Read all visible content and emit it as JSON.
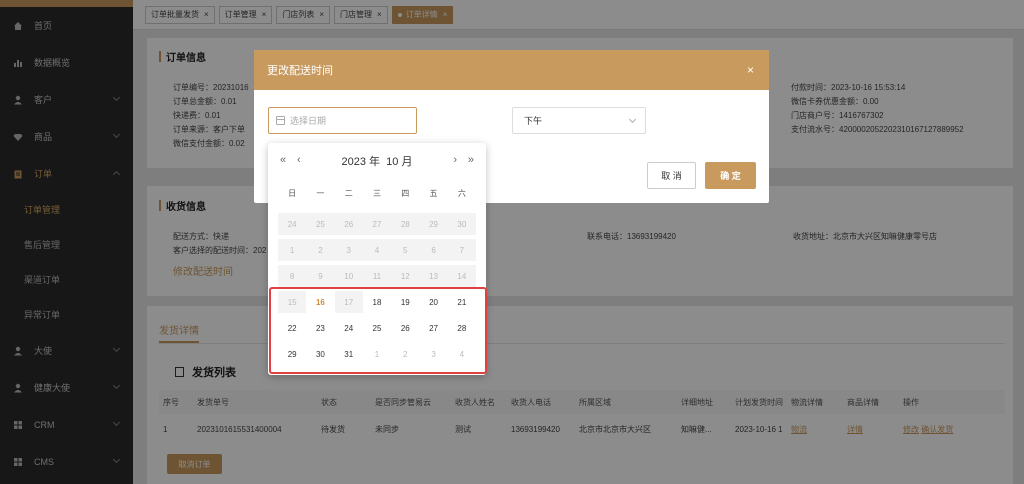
{
  "sidebar": {
    "items": [
      {
        "label": "首页",
        "icon": "home-icon"
      },
      {
        "label": "数据概览",
        "icon": "chart-icon"
      },
      {
        "label": "客户",
        "icon": "user-icon"
      },
      {
        "label": "商品",
        "icon": "diamond-icon"
      },
      {
        "label": "订单",
        "icon": "clipboard-icon"
      }
    ],
    "sub_items": [
      "订单管理",
      "售后管理",
      "渠道订单",
      "异常订单"
    ],
    "bottom_items": [
      {
        "label": "大使",
        "icon": "user-icon"
      },
      {
        "label": "健康大使",
        "icon": "user-icon"
      },
      {
        "label": "CRM",
        "icon": "grid-icon"
      },
      {
        "label": "CMS",
        "icon": "grid-icon"
      }
    ]
  },
  "tabs": [
    "订单批量发货",
    "订单管理",
    "门店列表",
    "门店管理",
    "订单详情"
  ],
  "order_info": {
    "title": "订单信息",
    "left": [
      "订单编号：20231016",
      "订单总金额：0.01",
      "快递费：0.01",
      "订单来源：客户下单",
      "微信支付金额：0.02"
    ],
    "right": [
      "付款时间：2023-10-16 15:53:14",
      "微信卡券优惠金额：0.00",
      "门店商户号：1416767302",
      "支付流水号：4200002052202310167127889952"
    ]
  },
  "receive_info": {
    "title": "收货信息",
    "method": "配送方式：快递",
    "chosen_time": "客户选择的配送时间：202",
    "modify_link": "修改配送时间",
    "phone": "联系电话：13693199420",
    "address": "收货地址：北京市大兴区知嘛健康零号店"
  },
  "ship": {
    "tab": "发货详情",
    "list_title": "发货列表",
    "headers": [
      "序号",
      "发货单号",
      "状态",
      "是否同步管易云",
      "收货人姓名",
      "收货人电话",
      "所属区域",
      "详细地址",
      "计划发货时间",
      "物流详情",
      "商品详情",
      "操作"
    ],
    "row": [
      "1",
      "2023101615531400004",
      "待发货",
      "未同步",
      "测试",
      "13693199420",
      "北京市北京市大兴区",
      "知嘛健...",
      "2023-10-16 1"
    ],
    "row_links": {
      "logistics": "物流",
      "detail": "详情",
      "edit": "修改",
      "confirm": "确认发货"
    },
    "cancel_btn": "取消订单"
  },
  "modal": {
    "title": "更改配送时间",
    "date_placeholder": "选择日期",
    "period": "下午",
    "cancel": "取 消",
    "ok": "确 定",
    "close": "×"
  },
  "picker": {
    "month_label": "2023 年  10 月",
    "prev_year": "«",
    "prev_month": "‹",
    "next_month": "›",
    "next_year": "»",
    "weekdays": [
      "日",
      "一",
      "二",
      "三",
      "四",
      "五",
      "六"
    ],
    "weeks": [
      [
        "24",
        "25",
        "26",
        "27",
        "28",
        "29",
        "30"
      ],
      [
        "1",
        "2",
        "3",
        "4",
        "5",
        "6",
        "7"
      ],
      [
        "8",
        "9",
        "10",
        "11",
        "12",
        "13",
        "14"
      ],
      [
        "15",
        "16",
        "17",
        "18",
        "19",
        "20",
        "21"
      ],
      [
        "22",
        "23",
        "24",
        "25",
        "26",
        "27",
        "28"
      ],
      [
        "29",
        "30",
        "31",
        "1",
        "2",
        "3",
        "4"
      ]
    ],
    "today": "16"
  },
  "colors": {
    "accent": "#c89a5e",
    "highlight": "#e04040"
  }
}
